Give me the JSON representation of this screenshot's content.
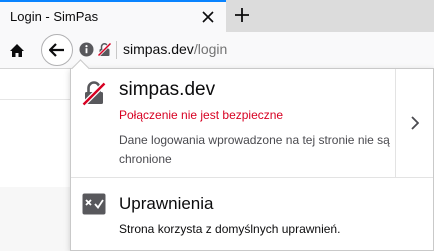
{
  "tab": {
    "title": "Login - SimPas"
  },
  "icons": {
    "close": "close-icon",
    "new_tab": "plus-icon",
    "home": "home-icon",
    "back": "back-arrow-icon",
    "info": "info-icon",
    "insecure_lock": "insecure-lock-icon",
    "chevron": "chevron-right-icon",
    "permissions": "permissions-icon"
  },
  "urlbar": {
    "host": "simpas.dev",
    "path": "/login"
  },
  "panel": {
    "site_name": "simpas.dev",
    "connection_status": "Połączenie nie jest bezpieczne",
    "connection_description": "Dane logowania wprowadzone na tej stronie nie są chronione",
    "permissions_title": "Uprawnienia",
    "permissions_description": "Strona korzysta z domyślnych uprawnień."
  },
  "colors": {
    "accent": "#0a84ff",
    "warning": "#d70022"
  }
}
